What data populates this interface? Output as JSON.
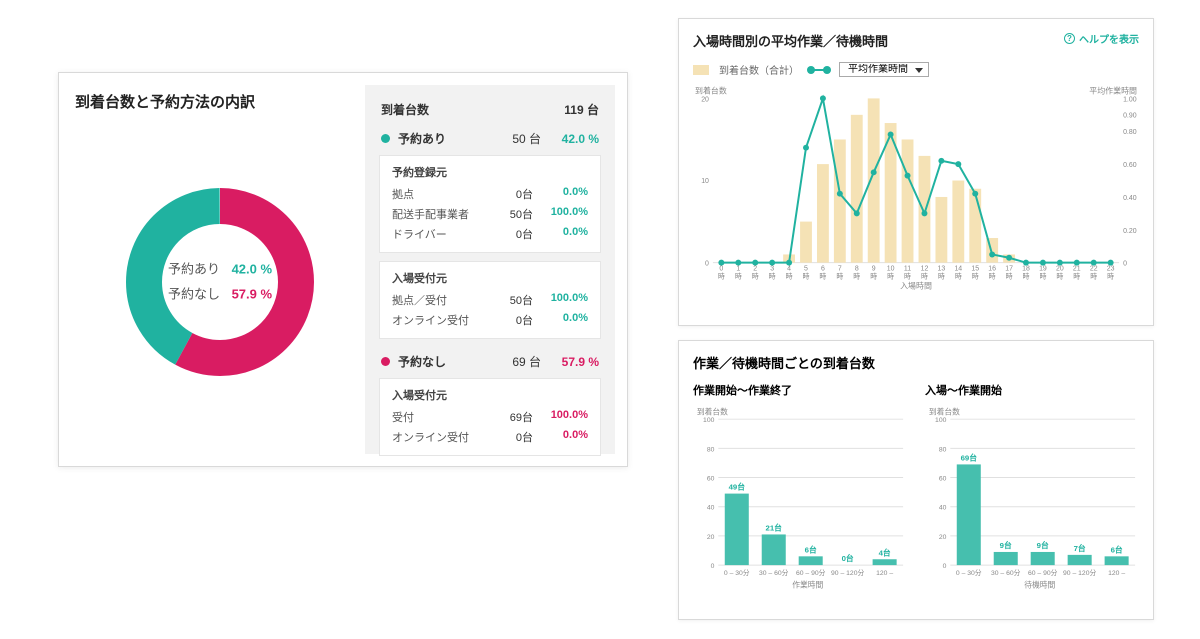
{
  "left": {
    "title": "到着台数と予約方法の内訳",
    "total_label": "到着台数",
    "total_value": "119 台",
    "reserved": {
      "label": "予約あり",
      "count": "50 台",
      "pct": "42.0 %",
      "block1_title": "予約登録元",
      "b1r1_l": "拠点",
      "b1r1_c": "0台",
      "b1r1_p": "0.0%",
      "b1r2_l": "配送手配事業者",
      "b1r2_c": "50台",
      "b1r2_p": "100.0%",
      "b1r3_l": "ドライバー",
      "b1r3_c": "0台",
      "b1r3_p": "0.0%",
      "block2_title": "入場受付元",
      "b2r1_l": "拠点／受付",
      "b2r1_c": "50台",
      "b2r1_p": "100.0%",
      "b2r2_l": "オンライン受付",
      "b2r2_c": "0台",
      "b2r2_p": "0.0%"
    },
    "unreserved": {
      "label": "予約なし",
      "count": "69 台",
      "pct": "57.9 %",
      "block_title": "入場受付元",
      "r1_l": "受付",
      "r1_c": "69台",
      "r1_p": "100.0%",
      "r2_l": "オンライン受付",
      "r2_c": "0台",
      "r2_p": "0.0%"
    },
    "donut_reserved_label": "予約あり",
    "donut_reserved_pct": "42.0 %",
    "donut_unreserved_label": "予約なし",
    "donut_unreserved_pct": "57.9 %"
  },
  "tr": {
    "title": "入場時間別の平均作業／待機時間",
    "help": "ヘルプを表示",
    "legend_bars": "到着台数（合計）",
    "select_label": "平均作業時間",
    "y_left_title": "到着台数",
    "y_right_title": "平均作業時間",
    "x_title": "入場時間",
    "y_left_max": "20",
    "y_left_mid": "10",
    "y_left_zero": "0",
    "y_right_ticks": [
      "1.00",
      "0.90",
      "0.80",
      "0.60",
      "0.40",
      "0.20",
      "0"
    ]
  },
  "br": {
    "title": "作業／待機時間ごとの到着台数",
    "left_title": "作業開始〜作業終了",
    "right_title": "入場〜作業開始",
    "y_title": "到着台数",
    "x_left_title": "作業時間",
    "x_right_title": "待機時間",
    "cats": [
      "0 – 30分",
      "30 – 60分",
      "60 – 90分",
      "90 – 120分",
      "120 –"
    ],
    "y_ticks": [
      "0",
      "20",
      "40",
      "60",
      "80",
      "100"
    ],
    "left_vals_labels": [
      "49台",
      "21台",
      "6台",
      "0台",
      "4台"
    ],
    "right_vals_labels": [
      "69台",
      "9台",
      "9台",
      "7台",
      "6台"
    ]
  },
  "colors": {
    "teal": "#20b2a0",
    "magenta": "#d91c62",
    "bar_pale": "#f5e2b5"
  },
  "chart_data": [
    {
      "type": "pie",
      "title": "到着台数と予約方法の内訳",
      "categories": [
        "予約あり",
        "予約なし"
      ],
      "values": [
        42.0,
        57.9
      ],
      "counts": [
        50,
        69
      ],
      "total": 119
    },
    {
      "type": "bar",
      "title": "入場時間別の平均作業／待機時間 — 到着台数（合計）",
      "xlabel": "入場時間",
      "ylabel": "到着台数",
      "categories": [
        "0時",
        "1時",
        "2時",
        "3時",
        "4時",
        "5時",
        "6時",
        "7時",
        "8時",
        "9時",
        "10時",
        "11時",
        "12時",
        "13時",
        "14時",
        "15時",
        "16時",
        "17時",
        "18時",
        "19時",
        "20時",
        "21時",
        "22時",
        "23時"
      ],
      "values": [
        0,
        0,
        0,
        0,
        1,
        5,
        12,
        15,
        18,
        20,
        17,
        15,
        13,
        8,
        10,
        9,
        3,
        1,
        0,
        0,
        0,
        0,
        0,
        0
      ],
      "ylim": [
        0,
        20
      ],
      "overlay_series": {
        "name": "平均作業時間",
        "type": "line",
        "values": [
          0,
          0,
          0,
          0,
          0,
          0.7,
          1.0,
          0.42,
          0.3,
          0.55,
          0.78,
          0.53,
          0.3,
          0.62,
          0.6,
          0.42,
          0.05,
          0.03,
          0,
          0,
          0,
          0,
          0,
          0
        ],
        "ylim": [
          0,
          1.0
        ]
      }
    },
    {
      "type": "bar",
      "title": "作業開始〜作業終了",
      "xlabel": "作業時間",
      "ylabel": "到着台数",
      "categories": [
        "0 – 30分",
        "30 – 60分",
        "60 – 90分",
        "90 – 120分",
        "120 –"
      ],
      "values": [
        49,
        21,
        6,
        0,
        4
      ],
      "ylim": [
        0,
        100
      ]
    },
    {
      "type": "bar",
      "title": "入場〜作業開始",
      "xlabel": "待機時間",
      "ylabel": "到着台数",
      "categories": [
        "0 – 30分",
        "30 – 60分",
        "60 – 90分",
        "90 – 120分",
        "120 –"
      ],
      "values": [
        69,
        9,
        9,
        7,
        6
      ],
      "ylim": [
        0,
        100
      ]
    }
  ]
}
